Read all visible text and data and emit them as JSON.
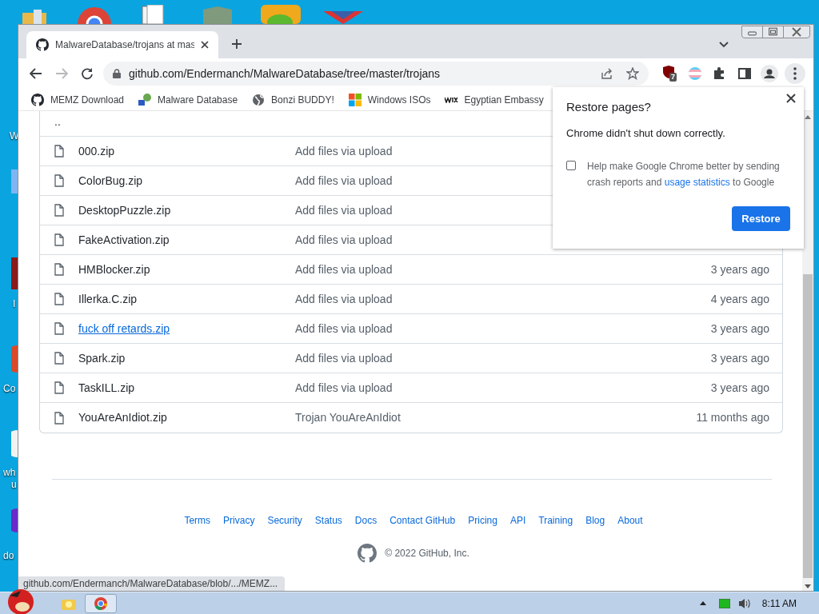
{
  "desktop": {
    "icon_labels": [
      "W",
      "I",
      "Co",
      "wh",
      "u",
      "do"
    ]
  },
  "browser": {
    "tab": {
      "title": "MalwareDatabase/trojans at mas",
      "selected": true
    },
    "url": "github.com/Endermanch/MalwareDatabase/tree/master/trojans",
    "extension_badge": "7",
    "bookmarks": [
      {
        "label": "MEMZ Download",
        "kind": "github"
      },
      {
        "label": "Malware Database",
        "kind": "network"
      },
      {
        "label": "Bonzi BUDDY!",
        "kind": "globe"
      },
      {
        "label": "Windows ISOs",
        "kind": "windows"
      },
      {
        "label": "Egyptian Embassy",
        "kind": "wix"
      }
    ]
  },
  "file_list": {
    "parent_row": "..",
    "rows": [
      {
        "name": "000.zip",
        "message": "Add files via upload",
        "hovered": false
      },
      {
        "name": "ColorBug.zip",
        "message": "Add files via upload",
        "hovered": false
      },
      {
        "name": "DesktopPuzzle.zip",
        "message": "Add files via upload",
        "hovered": false
      },
      {
        "name": "FakeActivation.zip",
        "message": "Add files via upload",
        "hovered": false
      },
      {
        "name": "HMBlocker.zip",
        "message": "Add files via upload",
        "age": "3 years ago",
        "hovered": false
      },
      {
        "name": "Illerka.C.zip",
        "message": "Add files via upload",
        "age": "4 years ago",
        "hovered": false
      },
      {
        "name": "fuck off retards.zip",
        "message": "Add files via upload",
        "age": "3 years ago",
        "hovered": true
      },
      {
        "name": "Spark.zip",
        "message": "Add files via upload",
        "age": "3 years ago",
        "hovered": false
      },
      {
        "name": "TaskILL.zip",
        "message": "Add files via upload",
        "age": "3 years ago",
        "hovered": false
      },
      {
        "name": "YouAreAnIdiot.zip",
        "message": "Trojan YouAreAnIdiot",
        "age": "11 months ago",
        "hovered": false
      }
    ]
  },
  "footer": {
    "links": [
      "Terms",
      "Privacy",
      "Security",
      "Status",
      "Docs",
      "Contact GitHub",
      "Pricing",
      "API",
      "Training",
      "Blog",
      "About"
    ],
    "copyright": "© 2022 GitHub, Inc."
  },
  "status_bubble": "github.com/Endermanch/MalwareDatabase/blob/.../MEMZ...",
  "restore_popup": {
    "title": "Restore pages?",
    "message": "Chrome didn't shut down correctly.",
    "checkbox": {
      "text_before": "Help make Google Chrome better by sending crash reports and",
      "link": "usage statistics",
      "text_after": "to Google",
      "checked": false
    },
    "button": "Restore"
  },
  "taskbar": {
    "items": [
      {
        "kind": "explorer",
        "selected": false
      },
      {
        "kind": "chrome",
        "selected": true
      }
    ],
    "clock": "8:11 AM"
  }
}
